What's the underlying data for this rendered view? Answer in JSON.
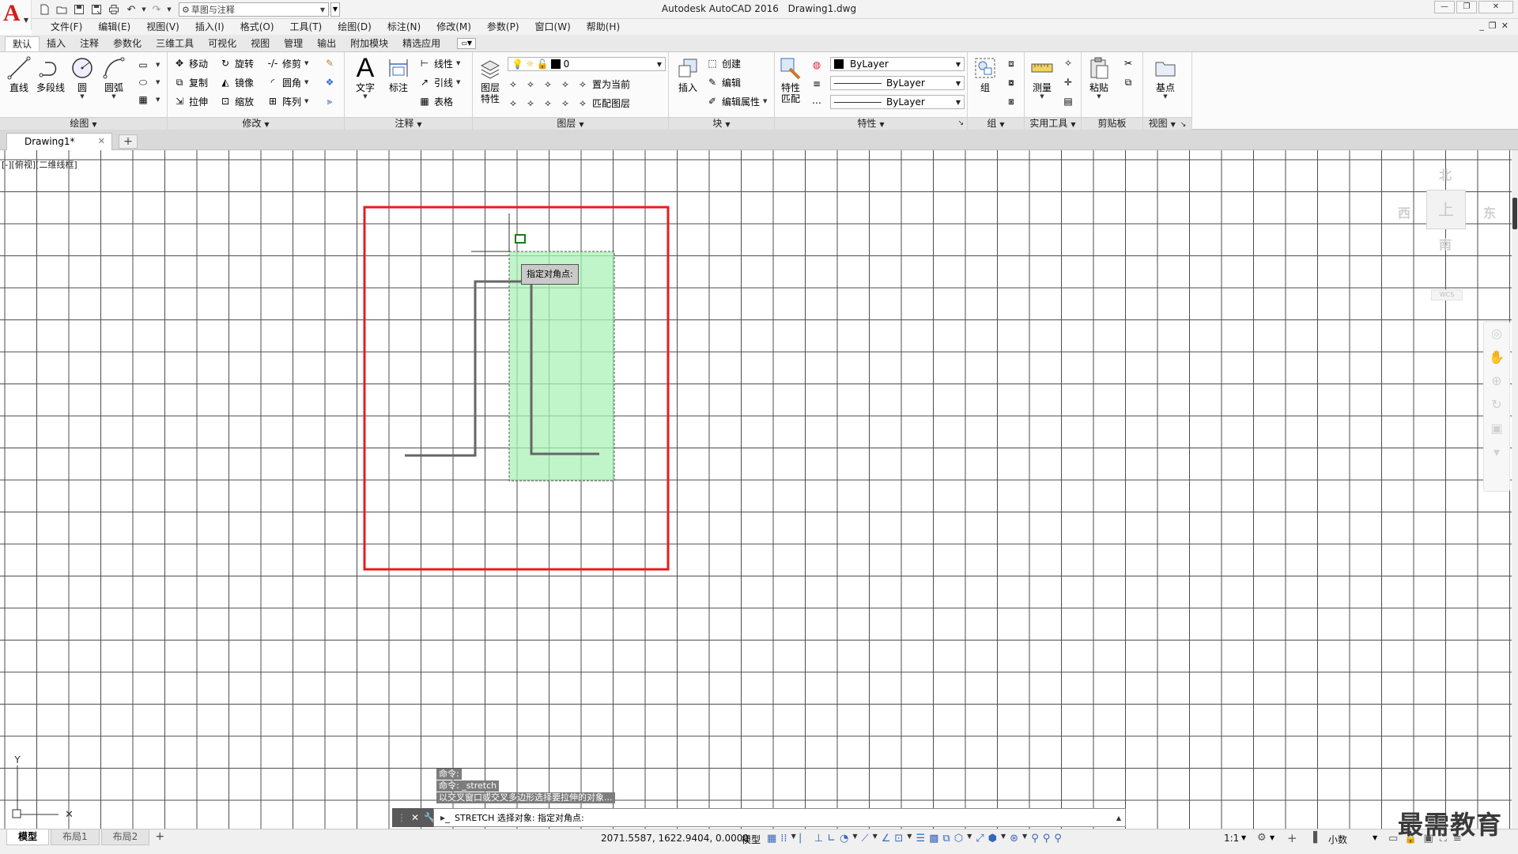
{
  "window": {
    "app_name": "Autodesk AutoCAD 2016",
    "file_name": "Drawing1.dwg",
    "workspace": "草图与注释"
  },
  "menu": [
    "文件(F)",
    "编辑(E)",
    "视图(V)",
    "插入(I)",
    "格式(O)",
    "工具(T)",
    "绘图(D)",
    "标注(N)",
    "修改(M)",
    "参数(P)",
    "窗口(W)",
    "帮助(H)"
  ],
  "ribbon_tabs": [
    "默认",
    "插入",
    "注释",
    "参数化",
    "三维工具",
    "可视化",
    "视图",
    "管理",
    "输出",
    "附加模块",
    "精选应用"
  ],
  "ribbon": {
    "draw": {
      "title": "绘图",
      "line": "直线",
      "polyline": "多段线",
      "circle": "圆",
      "arc": "圆弧"
    },
    "modify": {
      "title": "修改",
      "move": "移动",
      "rotate": "旋转",
      "trim": "修剪",
      "copy": "复制",
      "mirror": "镜像",
      "fillet": "圆角",
      "stretch": "拉伸",
      "scale": "缩放",
      "array": "阵列"
    },
    "annotation": {
      "title": "注释",
      "text": "文字",
      "dimension": "标注",
      "linear": "线性",
      "leader": "引线",
      "table": "表格"
    },
    "layers": {
      "title": "图层",
      "layer_props_1": "图层",
      "layer_props_2": "特性",
      "current_layer": "0",
      "set_current": "置为当前",
      "match_layer": "匹配图层"
    },
    "block": {
      "title": "块",
      "insert": "插入",
      "create": "创建",
      "edit": "编辑",
      "edit_attr": "编辑属性"
    },
    "properties": {
      "title": "特性",
      "match_1": "特性",
      "match_2": "匹配",
      "color": "ByLayer",
      "linetype": "ByLayer",
      "lineweight": "ByLayer"
    },
    "groups": {
      "title": "组",
      "group": "组"
    },
    "utilities": {
      "title": "实用工具",
      "measure": "测量"
    },
    "clipboard": {
      "title": "剪贴板",
      "paste": "粘贴"
    },
    "view": {
      "title": "视图",
      "base": "基点"
    }
  },
  "doc_tab": "Drawing1*",
  "viewport_label": "[-][俯视][二维线框]",
  "cursor_tooltip": "指定对角点:",
  "viewcube": {
    "north": "北",
    "south": "南",
    "east": "东",
    "west": "西",
    "face": "上",
    "wcs": "WCS"
  },
  "command": {
    "history": [
      "命令:",
      "命令:  _stretch",
      "以交叉窗口或交叉多边形选择要拉伸的对象..."
    ],
    "prompt": "STRETCH 选择对象: 指定对角点:"
  },
  "layout_tabs": [
    "模型",
    "布局1",
    "布局2"
  ],
  "status": {
    "coords": "2071.5587, 1622.9404, 0.0000",
    "model": "模型",
    "scale": "1:1",
    "units": "小数"
  },
  "watermark": "最需教育",
  "colors": {
    "highlight_rect": "#e81c1c",
    "crossing_window": "#a9f2b5",
    "grid": "#4d4d4d"
  }
}
